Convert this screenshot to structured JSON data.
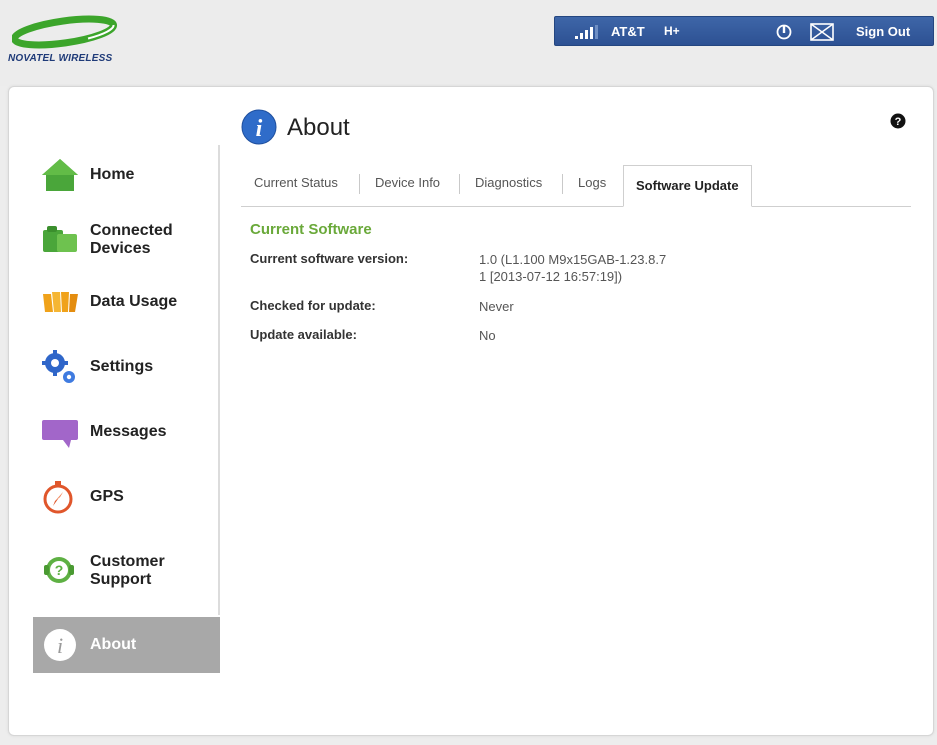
{
  "header": {
    "brand": "NOVATEL WIRELESS",
    "carrier": "AT&T",
    "network_type": "H+",
    "sign_out_label": "Sign Out"
  },
  "sidebar": {
    "items": [
      {
        "label": "Home",
        "icon": "home-icon"
      },
      {
        "label": "Connected Devices",
        "icon": "connected-devices-icon"
      },
      {
        "label": "Data Usage",
        "icon": "data-usage-icon"
      },
      {
        "label": "Settings",
        "icon": "settings-icon"
      },
      {
        "label": "Messages",
        "icon": "messages-icon"
      },
      {
        "label": "GPS",
        "icon": "gps-icon"
      },
      {
        "label": "Customer Support",
        "icon": "customer-support-icon"
      },
      {
        "label": "About",
        "icon": "about-icon",
        "active": true
      }
    ]
  },
  "main": {
    "title": "About",
    "tabs": [
      {
        "label": "Current Status"
      },
      {
        "label": "Device Info"
      },
      {
        "label": "Diagnostics"
      },
      {
        "label": "Logs"
      },
      {
        "label": "Software Update",
        "active": true
      }
    ],
    "section_title": "Current Software",
    "fields": [
      {
        "label": "Current software version:",
        "value_line1": "1.0 (L1.100 M9x15GAB-1.23.8.7",
        "value_line2": "1 [2013-07-12 16:57:19])"
      },
      {
        "label": "Checked for update:",
        "value": "Never"
      },
      {
        "label": "Update available:",
        "value": "No"
      }
    ]
  },
  "colors": {
    "accent_green": "#6aa93a",
    "header_blue": "#2d5193",
    "active_nav_gray": "#a8a8a8"
  }
}
